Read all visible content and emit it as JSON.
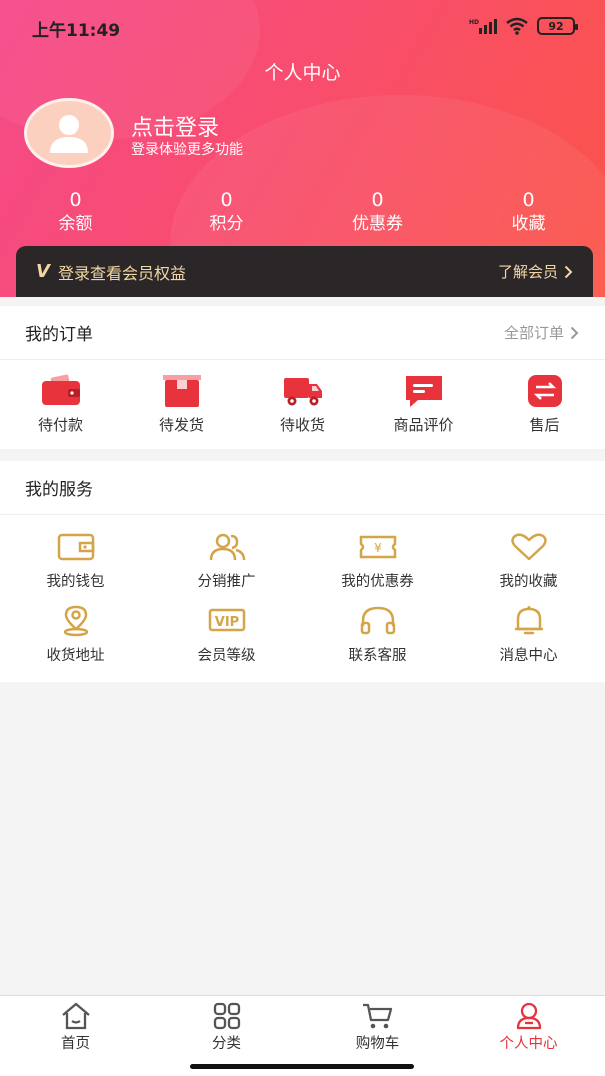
{
  "status_bar": {
    "time": "上午11:49",
    "battery": "92",
    "network_badge": "HD"
  },
  "header": {
    "title": "个人中心",
    "login_title": "点击登录",
    "login_subtitle": "登录体验更多功能",
    "stats": [
      {
        "value": "0",
        "label": "余额"
      },
      {
        "value": "0",
        "label": "积分"
      },
      {
        "value": "0",
        "label": "优惠券"
      },
      {
        "value": "0",
        "label": "收藏"
      }
    ]
  },
  "vip": {
    "badge": "V",
    "text": "登录查看会员权益",
    "link": "了解会员"
  },
  "orders": {
    "title": "我的订单",
    "link": "全部订单",
    "items": [
      {
        "label": "待付款",
        "icon": "wallet-icon"
      },
      {
        "label": "待发货",
        "icon": "box-icon"
      },
      {
        "label": "待收货",
        "icon": "truck-icon"
      },
      {
        "label": "商品评价",
        "icon": "comment-icon"
      },
      {
        "label": "售后",
        "icon": "exchange-icon"
      }
    ]
  },
  "services": {
    "title": "我的服务",
    "items": [
      {
        "label": "我的钱包",
        "icon": "wallet-icon"
      },
      {
        "label": "分销推广",
        "icon": "users-icon"
      },
      {
        "label": "我的优惠券",
        "icon": "coupon-icon"
      },
      {
        "label": "我的收藏",
        "icon": "heart-icon"
      },
      {
        "label": "收货地址",
        "icon": "location-icon"
      },
      {
        "label": "会员等级",
        "icon": "vip-icon",
        "icon_text": "VIP"
      },
      {
        "label": "联系客服",
        "icon": "headset-icon"
      },
      {
        "label": "消息中心",
        "icon": "bell-icon"
      }
    ]
  },
  "coupon_icon_text": "¥",
  "tabbar": {
    "items": [
      {
        "label": "首页",
        "icon": "home-icon"
      },
      {
        "label": "分类",
        "icon": "grid-icon"
      },
      {
        "label": "购物车",
        "icon": "cart-icon"
      },
      {
        "label": "个人中心",
        "icon": "user-icon",
        "active": true
      }
    ]
  },
  "colors": {
    "accent": "#e8323c",
    "service_icon": "#d4a548",
    "vip_text": "#f2d7a5",
    "header_start": "#f5498a",
    "header_end": "#fb5447"
  }
}
